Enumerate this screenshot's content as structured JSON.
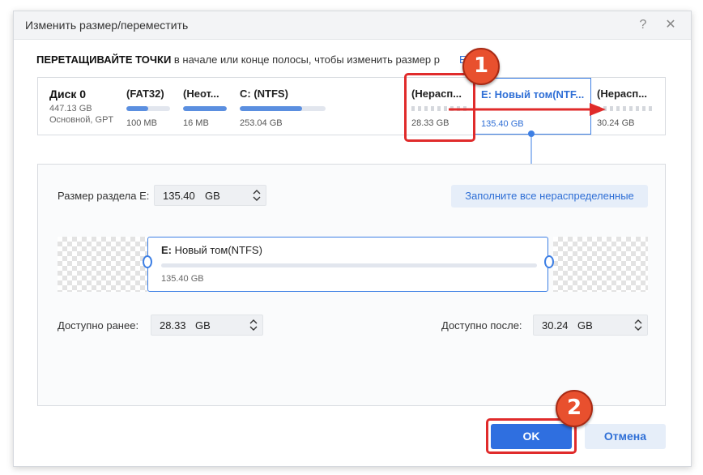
{
  "window": {
    "title": "Изменить размер/переместить",
    "help_glyph": "?",
    "close_glyph": "✕"
  },
  "instruction": {
    "bold": "ПЕРЕТАЩИВАЙТЕ ТОЧКИ",
    "text": " в начале или конце полосы, чтобы изменить размер р",
    "link": "E:"
  },
  "disk": {
    "name": "Диск 0",
    "size": "447.13 GB",
    "type": "Основной, GPT"
  },
  "partitions": [
    {
      "name": "(FAT32)",
      "size": "100 MB",
      "used_fraction": 0.5,
      "unallocated": false
    },
    {
      "name": "(Неот...",
      "size": "16 MB",
      "used_fraction": 1.0,
      "unallocated": false
    },
    {
      "name": "C: (NTFS)",
      "size": "253.04 GB",
      "used_fraction": 0.73,
      "unallocated": false
    },
    {
      "name": "(Нерасп...",
      "size": "28.33 GB",
      "used_fraction": 0,
      "unallocated": true
    },
    {
      "name": "E: Новый том(NTF...",
      "size": "135.40 GB",
      "used_fraction": 0,
      "unallocated": false,
      "selected": true
    },
    {
      "name": "(Нерасп...",
      "size": "30.24 GB",
      "used_fraction": 0,
      "unallocated": true
    }
  ],
  "callouts": {
    "step1": "1",
    "step2": "2"
  },
  "resize_panel": {
    "size_label": "Размер раздела E:",
    "size_value": "135.40",
    "size_unit": "GB",
    "fill_button": "Заполните все нераспределенные",
    "volume_letter": "E:",
    "volume_name": " Новый том(NTFS)",
    "volume_size": "135.40 GB",
    "before_label": "Доступно ранее:",
    "before_value": "28.33",
    "before_unit": "GB",
    "after_label": "Доступно после:",
    "after_value": "30.24",
    "after_unit": "GB"
  },
  "footer": {
    "ok_label": "OK",
    "cancel_label": "Отмена"
  },
  "colors": {
    "accent": "#2f6fe0",
    "callout_red": "#e02b2b",
    "badge_orange": "#e8502e"
  }
}
